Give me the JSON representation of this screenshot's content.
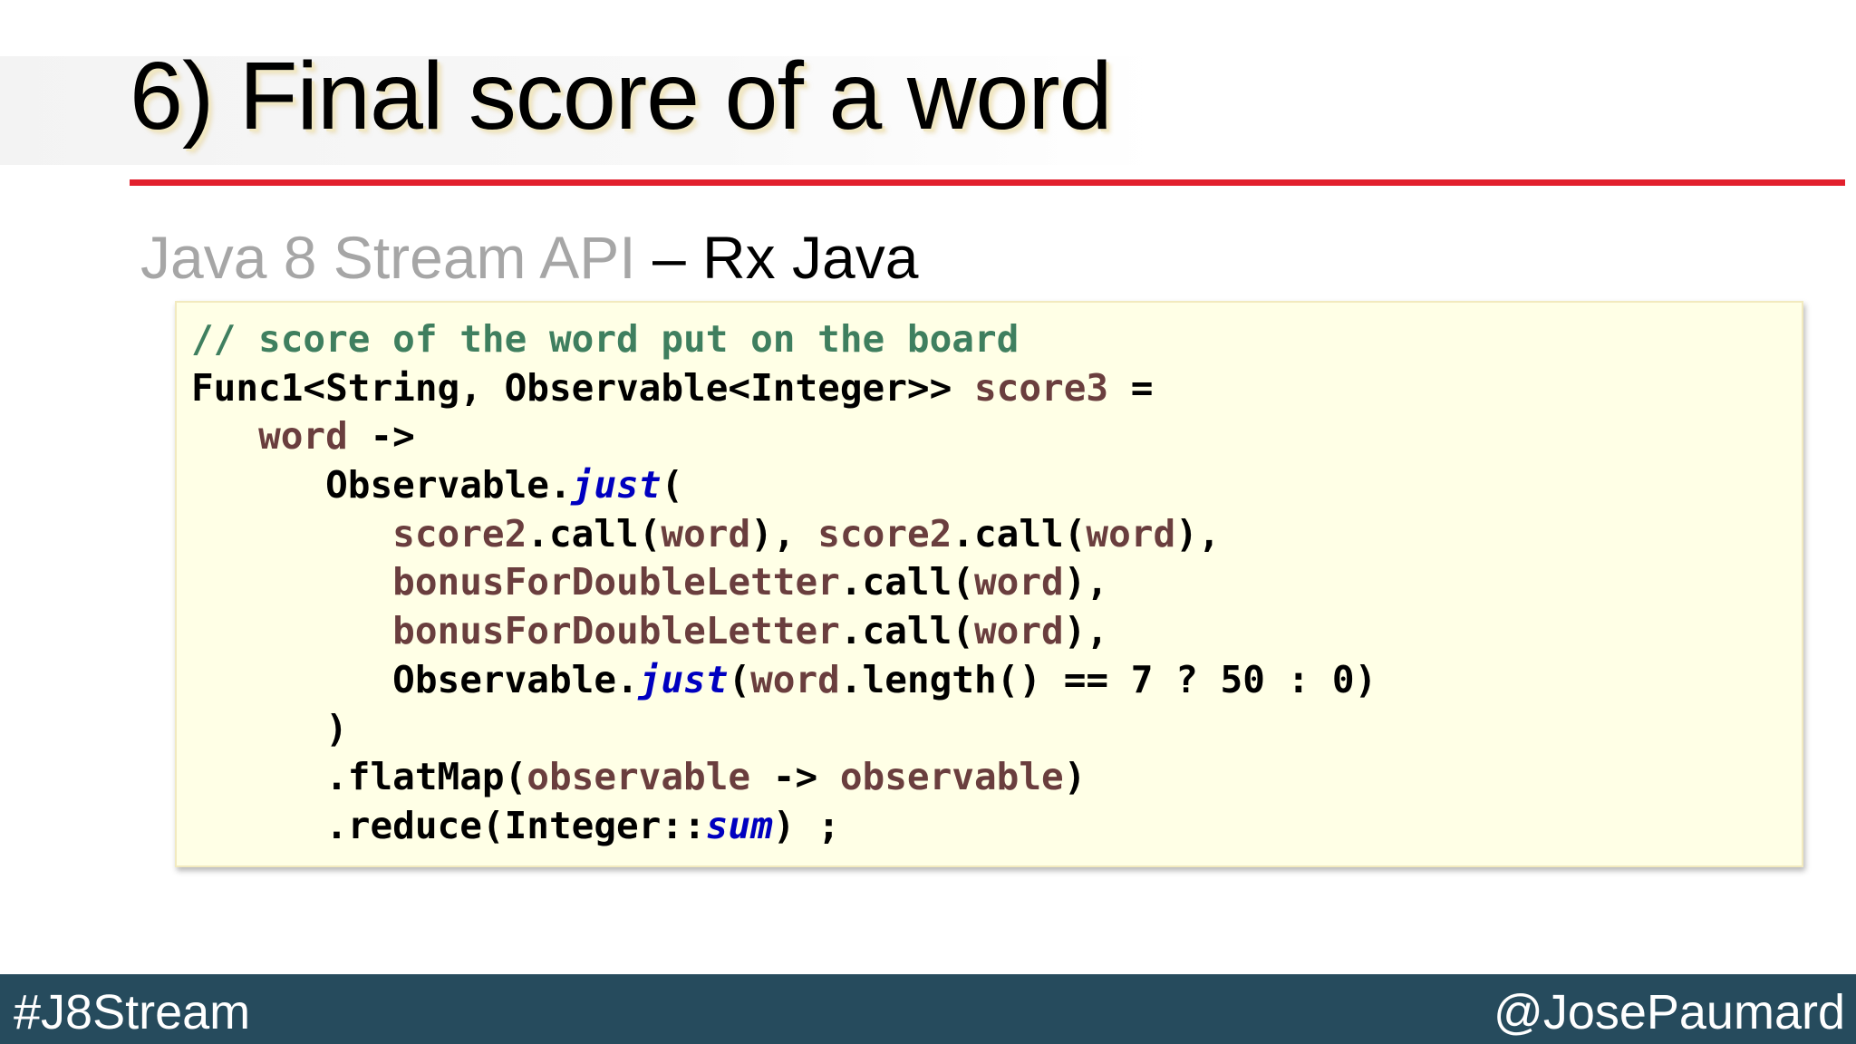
{
  "slide": {
    "title": "6) Final score of a word",
    "subtitle_muted": "Java 8 Stream API",
    "subtitle_active": "– Rx Java"
  },
  "code": {
    "lines": [
      [
        {
          "t": "// score of the word put on the board",
          "k": "comment"
        }
      ],
      [
        {
          "t": "Func1<String, Observable<Integer>> ",
          "k": "plain"
        },
        {
          "t": "score3",
          "k": "var"
        },
        {
          "t": " =",
          "k": "plain"
        }
      ],
      [
        {
          "t": "   ",
          "k": "plain"
        },
        {
          "t": "word",
          "k": "var"
        },
        {
          "t": " ->",
          "k": "plain"
        }
      ],
      [
        {
          "t": "      Observable.",
          "k": "plain"
        },
        {
          "t": "just",
          "k": "static"
        },
        {
          "t": "(",
          "k": "plain"
        }
      ],
      [
        {
          "t": "         ",
          "k": "plain"
        },
        {
          "t": "score2",
          "k": "var"
        },
        {
          "t": ".call(",
          "k": "plain"
        },
        {
          "t": "word",
          "k": "var"
        },
        {
          "t": "), ",
          "k": "plain"
        },
        {
          "t": "score2",
          "k": "var"
        },
        {
          "t": ".call(",
          "k": "plain"
        },
        {
          "t": "word",
          "k": "var"
        },
        {
          "t": "),",
          "k": "plain"
        }
      ],
      [
        {
          "t": "         ",
          "k": "plain"
        },
        {
          "t": "bonusForDoubleLetter",
          "k": "var"
        },
        {
          "t": ".call(",
          "k": "plain"
        },
        {
          "t": "word",
          "k": "var"
        },
        {
          "t": "),",
          "k": "plain"
        }
      ],
      [
        {
          "t": "         ",
          "k": "plain"
        },
        {
          "t": "bonusForDoubleLetter",
          "k": "var"
        },
        {
          "t": ".call(",
          "k": "plain"
        },
        {
          "t": "word",
          "k": "var"
        },
        {
          "t": "),",
          "k": "plain"
        }
      ],
      [
        {
          "t": "         Observable.",
          "k": "plain"
        },
        {
          "t": "just",
          "k": "static"
        },
        {
          "t": "(",
          "k": "plain"
        },
        {
          "t": "word",
          "k": "var"
        },
        {
          "t": ".length() == 7 ? 50 : 0)",
          "k": "plain"
        }
      ],
      [
        {
          "t": "      )",
          "k": "plain"
        }
      ],
      [
        {
          "t": "      .flatMap(",
          "k": "plain"
        },
        {
          "t": "observable",
          "k": "var"
        },
        {
          "t": " -> ",
          "k": "plain"
        },
        {
          "t": "observable",
          "k": "var"
        },
        {
          "t": ")",
          "k": "plain"
        }
      ],
      [
        {
          "t": "      .reduce(Integer::",
          "k": "plain"
        },
        {
          "t": "sum",
          "k": "static"
        },
        {
          "t": ") ;",
          "k": "plain"
        }
      ]
    ]
  },
  "footer": {
    "hashtag": "#J8Stream",
    "handle": "@JosePaumard"
  },
  "colors": {
    "accent_rule": "#e2202d",
    "footer_bg": "#264b5d",
    "code_bg": "#ffffe6",
    "comment": "#3f7f5f",
    "variable": "#6a3e3e",
    "static_method": "#0000c0"
  }
}
